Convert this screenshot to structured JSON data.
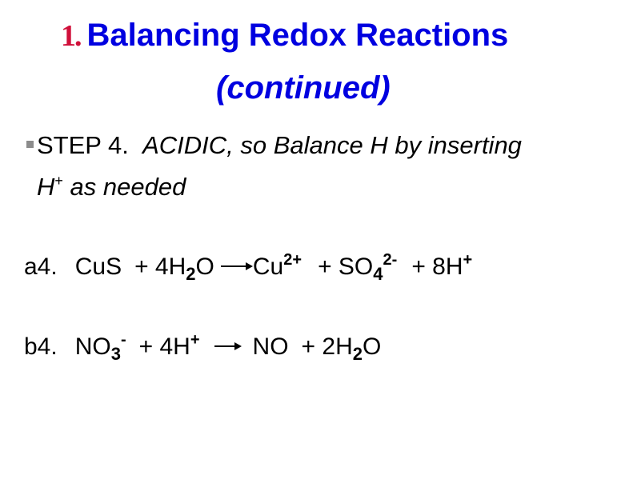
{
  "slide": {
    "title": {
      "number": "1.",
      "line1": "Balancing Redox Reactions",
      "line2": "(continued)",
      "number_color": "#d0103a",
      "title_color": "#0000e0"
    },
    "step": {
      "bullet_icon": "square-bullet",
      "label": "STEP 4.",
      "instruction_line1": "ACIDIC, so Balance H by inserting",
      "instruction_line2_h": "H",
      "instruction_line2_sup": "+",
      "instruction_line2_rest": " as needed"
    },
    "equations": [
      {
        "label": "a4.",
        "reactants": [
          {
            "text": "CuS"
          },
          {
            "prefix": "+ 4H",
            "sub": "2",
            "suffix": "O"
          }
        ],
        "arrow": "yields-arrow",
        "products": [
          {
            "text": "Cu",
            "sup": "2+"
          },
          {
            "prefix": "+ SO",
            "sub": "4",
            "sup": "2-"
          },
          {
            "prefix": "+ 8H",
            "sup": "+"
          }
        ]
      },
      {
        "label": "b4.",
        "reactants": [
          {
            "prefix": "NO",
            "sub": "3",
            "sup": "-"
          },
          {
            "prefix": "+ 4H",
            "sup": "+"
          }
        ],
        "arrow": "yields-arrow",
        "products": [
          {
            "text": "NO"
          },
          {
            "prefix": "+ 2H",
            "sub": "2",
            "suffix": "O"
          }
        ]
      }
    ]
  }
}
